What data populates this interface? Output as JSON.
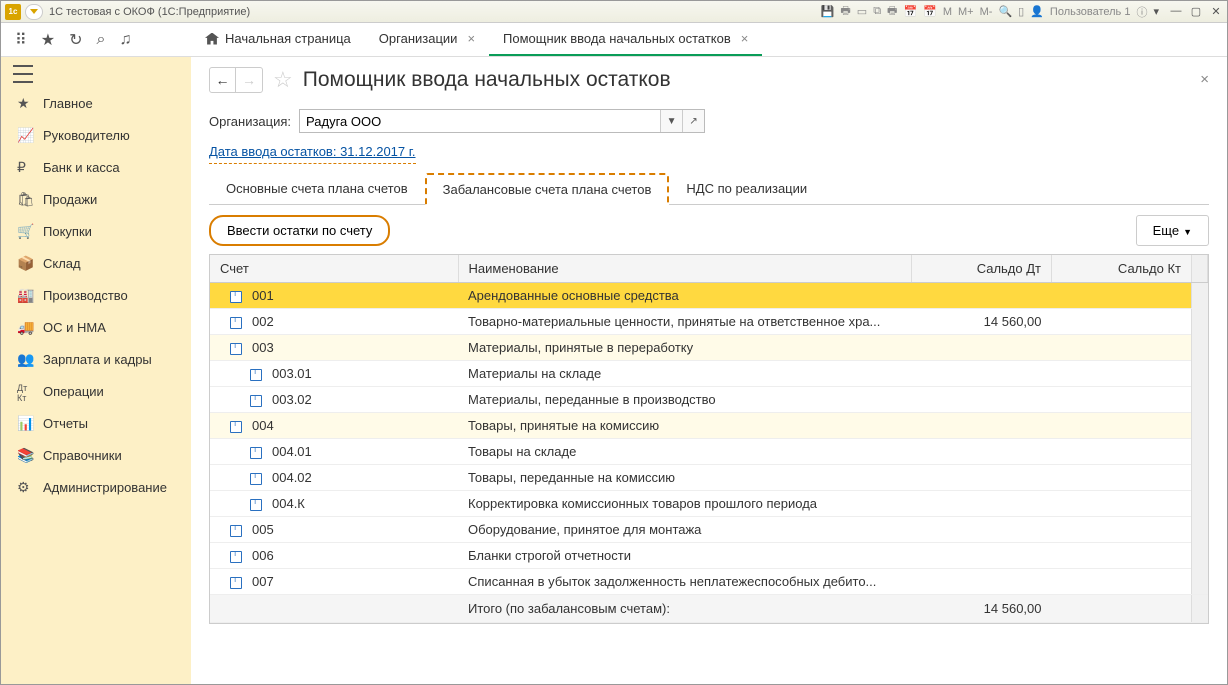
{
  "titlebar": {
    "title": "1С тестовая с ОКОФ  (1С:Предприятие)",
    "user_prefix": "Пользователь 1",
    "memory": {
      "m": "M",
      "mplus": "M+",
      "mminus": "M-"
    }
  },
  "topbar": {
    "home_tab": "Начальная страница",
    "tabs": [
      {
        "label": "Организации",
        "active": false
      },
      {
        "label": "Помощник ввода начальных остатков",
        "active": true
      }
    ]
  },
  "sidebar": {
    "items": [
      {
        "label": "Главное"
      },
      {
        "label": "Руководителю"
      },
      {
        "label": "Банк и касса"
      },
      {
        "label": "Продажи"
      },
      {
        "label": "Покупки"
      },
      {
        "label": "Склад"
      },
      {
        "label": "Производство"
      },
      {
        "label": "ОС и НМА"
      },
      {
        "label": "Зарплата и кадры"
      },
      {
        "label": "Операции"
      },
      {
        "label": "Отчеты"
      },
      {
        "label": "Справочники"
      },
      {
        "label": "Администрирование"
      }
    ]
  },
  "page": {
    "title": "Помощник ввода начальных остатков",
    "org_label": "Организация:",
    "org_value": "Радуга ООО",
    "date_link": "Дата ввода остатков: 31.12.2017 г.",
    "tabs": [
      "Основные счета плана счетов",
      "Забалансовые счета плана счетов",
      "НДС по реализации"
    ],
    "active_tab_index": 1,
    "enter_balances_btn": "Ввести остатки по счету",
    "more_btn": "Еще",
    "columns": {
      "account": "Счет",
      "name": "Наименование",
      "debit": "Сальдо Дт",
      "credit": "Сальдо Кт"
    },
    "rows": [
      {
        "code": "001",
        "name": "Арендованные основные средства",
        "dt": "",
        "kt": "",
        "selected": true,
        "indent": false
      },
      {
        "code": "002",
        "name": "Товарно-материальные ценности, принятые на ответственное хра...",
        "dt": "14 560,00",
        "kt": "",
        "indent": false
      },
      {
        "code": "003",
        "name": "Материалы, принятые в переработку",
        "dt": "",
        "kt": "",
        "alt": true,
        "indent": false
      },
      {
        "code": "003.01",
        "name": "Материалы на складе",
        "dt": "",
        "kt": "",
        "indent": true
      },
      {
        "code": "003.02",
        "name": "Материалы, переданные в производство",
        "dt": "",
        "kt": "",
        "indent": true
      },
      {
        "code": "004",
        "name": "Товары, принятые на комиссию",
        "dt": "",
        "kt": "",
        "alt": true,
        "indent": false
      },
      {
        "code": "004.01",
        "name": "Товары на складе",
        "dt": "",
        "kt": "",
        "indent": true
      },
      {
        "code": "004.02",
        "name": "Товары, переданные на комиссию",
        "dt": "",
        "kt": "",
        "indent": true
      },
      {
        "code": "004.К",
        "name": "Корректировка комиссионных товаров прошлого периода",
        "dt": "",
        "kt": "",
        "indent": true
      },
      {
        "code": "005",
        "name": "Оборудование, принятое для монтажа",
        "dt": "",
        "kt": "",
        "indent": false
      },
      {
        "code": "006",
        "name": "Бланки строгой отчетности",
        "dt": "",
        "kt": "",
        "indent": false
      },
      {
        "code": "007",
        "name": "Списанная в убыток задолженность неплатежеспособных дебито...",
        "dt": "",
        "kt": "",
        "indent": false
      }
    ],
    "footer": {
      "label": "Итого (по забалансовым счетам):",
      "dt": "14 560,00",
      "kt": ""
    }
  }
}
